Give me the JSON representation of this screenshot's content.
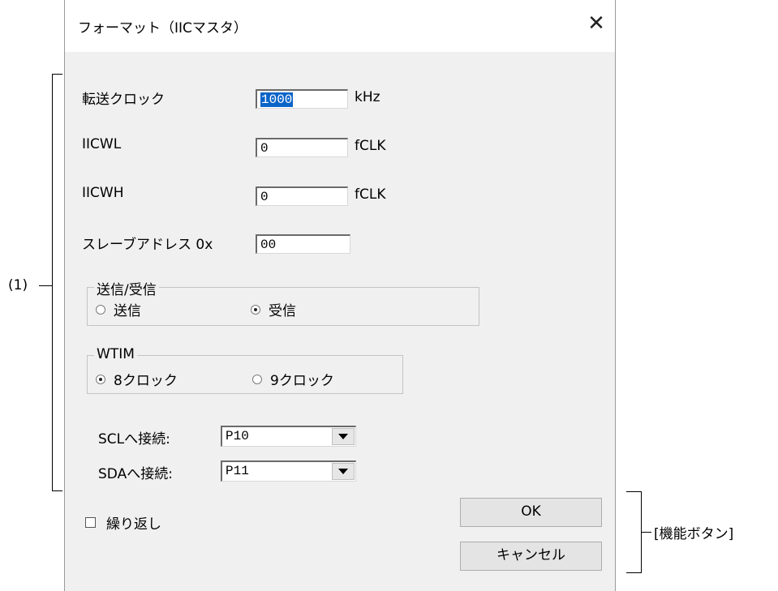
{
  "dialog": {
    "title": "フォーマット（IICマスタ）",
    "close_symbol": "✕"
  },
  "fields": {
    "clock_label": "転送クロック",
    "clock_value": "1000",
    "clock_unit": "kHz",
    "iicwl_label": "IICWL",
    "iicwl_value": "0",
    "iicwl_unit": "fCLK",
    "iicwh_label": "IICWH",
    "iicwh_value": "0",
    "iicwh_unit": "fCLK",
    "slave_label": "スレーブアドレス 0x",
    "slave_value": "00"
  },
  "txrx_group": {
    "legend": "送信/受信",
    "send_label": "送信",
    "receive_label": "受信",
    "selected": "receive"
  },
  "wtim_group": {
    "legend": "WTIM",
    "clk8_label": "8クロック",
    "clk9_label": "9クロック",
    "selected": "8"
  },
  "connections": {
    "scl_label": "SCLへ接続:",
    "scl_value": "P10",
    "sda_label": "SDAへ接続:",
    "sda_value": "P11"
  },
  "repeat": {
    "label": "繰り返し",
    "checked": false
  },
  "buttons": {
    "ok": "OK",
    "cancel": "キャンセル"
  },
  "annotations": {
    "area1": "(1)",
    "function_buttons": "[機能ボタン]"
  }
}
